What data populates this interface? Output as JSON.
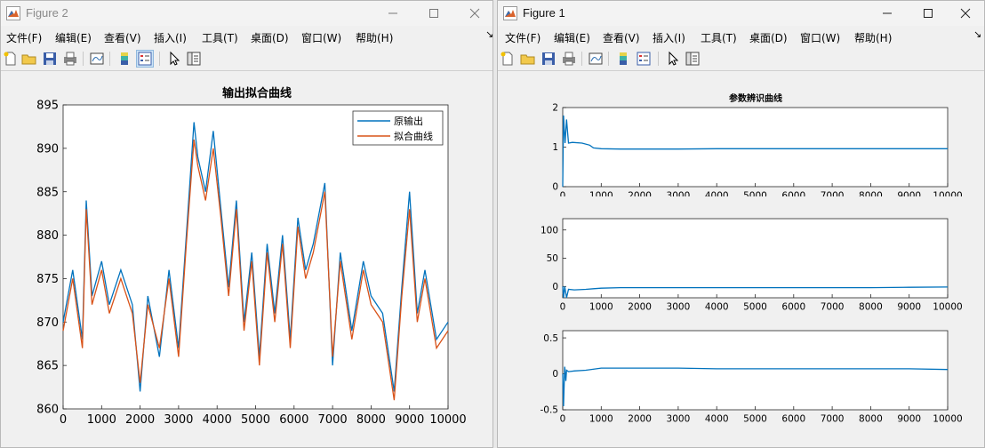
{
  "figure2": {
    "title": "Figure 2",
    "menu": [
      "文件(F)",
      "编辑(E)",
      "查看(V)",
      "插入(I)",
      "工具(T)",
      "桌面(D)",
      "窗口(W)",
      "帮助(H)"
    ],
    "toolbar_icons": [
      "new-file-icon",
      "open-folder-icon",
      "save-icon",
      "print-icon",
      "link-plot-icon",
      "colorbar-icon",
      "legend-icon",
      "pointer-icon",
      "property-editor-icon"
    ]
  },
  "figure1": {
    "title": "Figure 1",
    "menu": [
      "文件(F)",
      "编辑(E)",
      "查看(V)",
      "插入(I)",
      "工具(T)",
      "桌面(D)",
      "窗口(W)",
      "帮助(H)"
    ],
    "toolbar_icons": [
      "new-file-icon",
      "open-folder-icon",
      "save-icon",
      "print-icon",
      "link-plot-icon",
      "colorbar-icon",
      "legend-icon",
      "pointer-icon",
      "property-editor-icon"
    ]
  },
  "colors": {
    "series_blue": "#0072bd",
    "series_orange": "#d95319",
    "axes_bg": "#ffffff",
    "figure_bg": "#f0f0f0"
  },
  "chart_data": [
    {
      "type": "line",
      "title": "输出拟合曲线",
      "xlabel": "",
      "ylabel": "",
      "xlim": [
        0,
        10000
      ],
      "ylim": [
        860,
        895
      ],
      "xticks": [
        0,
        1000,
        2000,
        3000,
        4000,
        5000,
        6000,
        7000,
        8000,
        9000,
        10000
      ],
      "yticks": [
        860,
        865,
        870,
        875,
        880,
        885,
        890,
        895
      ],
      "grid": false,
      "legend_position": "top-right",
      "x": [
        0,
        250,
        500,
        600,
        750,
        1000,
        1200,
        1500,
        1800,
        2000,
        2200,
        2500,
        2750,
        3000,
        3200,
        3400,
        3500,
        3700,
        3900,
        4100,
        4300,
        4500,
        4700,
        4900,
        5100,
        5300,
        5500,
        5700,
        5900,
        6100,
        6300,
        6500,
        6800,
        7000,
        7200,
        7500,
        7800,
        8000,
        8300,
        8600,
        8800,
        9000,
        9200,
        9400,
        9700,
        10000
      ],
      "series": [
        {
          "name": "原输出",
          "values": [
            870,
            876,
            868,
            884,
            873,
            877,
            872,
            876,
            872,
            862,
            873,
            866,
            876,
            867,
            880,
            893,
            889,
            885,
            892,
            883,
            874,
            884,
            870,
            878,
            866,
            879,
            871,
            880,
            868,
            882,
            876,
            879,
            886,
            865,
            878,
            869,
            877,
            873,
            871,
            862,
            874,
            885,
            871,
            876,
            868,
            870
          ]
        },
        {
          "name": "拟合曲线",
          "values": [
            869,
            875,
            867,
            883,
            872,
            876,
            871,
            875,
            871,
            863,
            872,
            867,
            875,
            866,
            879,
            891,
            888,
            884,
            890,
            882,
            873,
            883,
            869,
            877,
            865,
            878,
            870,
            879,
            867,
            881,
            875,
            878,
            885,
            866,
            877,
            868,
            876,
            872,
            870,
            861,
            873,
            883,
            870,
            875,
            867,
            869
          ]
        }
      ]
    },
    {
      "type": "line",
      "title": "参数辨识曲线",
      "xlim": [
        0,
        10000
      ],
      "ylim": [
        0,
        2
      ],
      "xticks": [
        0,
        1000,
        2000,
        3000,
        4000,
        5000,
        6000,
        7000,
        8000,
        9000,
        10000
      ],
      "yticks": [
        0,
        1,
        2
      ],
      "grid": false,
      "x": [
        0,
        20,
        60,
        100,
        150,
        250,
        500,
        700,
        800,
        1000,
        1500,
        2000,
        3000,
        4000,
        5000,
        6000,
        7000,
        8000,
        9000,
        10000
      ],
      "series": [
        {
          "values": [
            0,
            1.8,
            1.1,
            1.7,
            1.1,
            1.12,
            1.1,
            1.05,
            0.98,
            0.96,
            0.95,
            0.95,
            0.95,
            0.96,
            0.96,
            0.96,
            0.96,
            0.96,
            0.96,
            0.96
          ]
        }
      ]
    },
    {
      "type": "line",
      "xlim": [
        0,
        10000
      ],
      "ylim": [
        -20,
        120
      ],
      "xticks": [
        0,
        1000,
        2000,
        3000,
        4000,
        5000,
        6000,
        7000,
        8000,
        9000,
        10000
      ],
      "yticks": [
        0,
        50,
        100
      ],
      "grid": false,
      "x": [
        0,
        20,
        50,
        100,
        150,
        300,
        600,
        800,
        1000,
        1500,
        2000,
        3000,
        4000,
        5000,
        6000,
        7000,
        8000,
        9000,
        10000
      ],
      "series": [
        {
          "values": [
            0,
            -25,
            0,
            -20,
            -5,
            -6,
            -5,
            -4,
            -3,
            -2,
            -2,
            -2,
            -2,
            -2,
            -2,
            -2,
            -2,
            -1.5,
            -1
          ]
        }
      ]
    },
    {
      "type": "line",
      "xlim": [
        0,
        10000
      ],
      "ylim": [
        -0.5,
        0.6
      ],
      "xticks": [
        0,
        1000,
        2000,
        3000,
        4000,
        5000,
        6000,
        7000,
        8000,
        9000,
        10000
      ],
      "yticks": [
        -0.5,
        0,
        0.5
      ],
      "grid": false,
      "x": [
        0,
        20,
        50,
        80,
        100,
        150,
        300,
        600,
        1000,
        1500,
        2000,
        3000,
        4000,
        5000,
        6000,
        7000,
        8000,
        9000,
        10000
      ],
      "series": [
        {
          "values": [
            0,
            -0.45,
            0.1,
            -0.1,
            0.05,
            0.03,
            0.04,
            0.05,
            0.08,
            0.08,
            0.08,
            0.08,
            0.07,
            0.07,
            0.07,
            0.07,
            0.07,
            0.07,
            0.06
          ]
        }
      ]
    }
  ]
}
